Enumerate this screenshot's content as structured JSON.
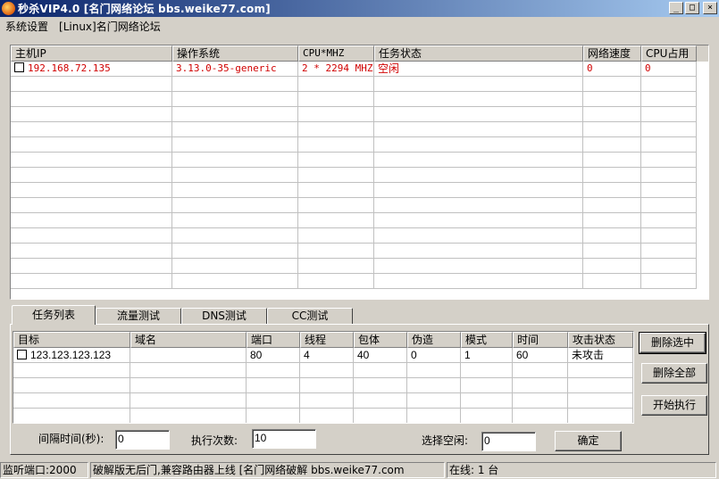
{
  "window": {
    "title": "秒杀VIP4.0 [名门网络论坛 bbs.weike77.com]",
    "minimize": "_",
    "maximize": "□",
    "close": "×"
  },
  "menu": [
    "系统设置",
    "[Linux]名门网络论坛"
  ],
  "hosts": {
    "columns": [
      "主机IP",
      "操作系统",
      "CPU*MHZ",
      "任务状态",
      "网络速度",
      "CPU占用"
    ],
    "rows": [
      {
        "ip": "192.168.72.135",
        "os": "3.13.0-35-generic",
        "cpu": "2 * 2294 MHZ",
        "status": "空闲",
        "speed": "0",
        "usage": "0"
      }
    ]
  },
  "tabs": [
    "任务列表",
    "流量测试",
    "DNS测试",
    "CC测试"
  ],
  "tasks": {
    "columns": [
      "目标",
      "域名",
      "端口",
      "线程",
      "包体",
      "伪造",
      "模式",
      "时间",
      "攻击状态"
    ],
    "rows": [
      {
        "target": "123.123.123.123",
        "domain": "",
        "port": "80",
        "threads": "4",
        "packet": "40",
        "fake": "0",
        "mode": "1",
        "time": "60",
        "state": "未攻击"
      }
    ]
  },
  "buttons": {
    "delete_selected": "删除选中",
    "delete_all": "删除全部",
    "start": "开始执行",
    "confirm": "确定"
  },
  "settings": {
    "interval_label": "间隔时间(秒):",
    "interval_value": "0",
    "count_label": "执行次数:",
    "count_value": "10",
    "idle_label": "选择空闲:",
    "idle_value": "0"
  },
  "status": {
    "port": "监听端口:2000",
    "message": "破解版无后门,兼容路由器上线 [名门网络破解 bbs.weike77.com",
    "online": "在线: 1 台"
  },
  "colors": {
    "titlebar_start": "#0a246a",
    "titlebar_end": "#a6caf0",
    "host_text": "#d00000",
    "face": "#d4d0c8"
  }
}
